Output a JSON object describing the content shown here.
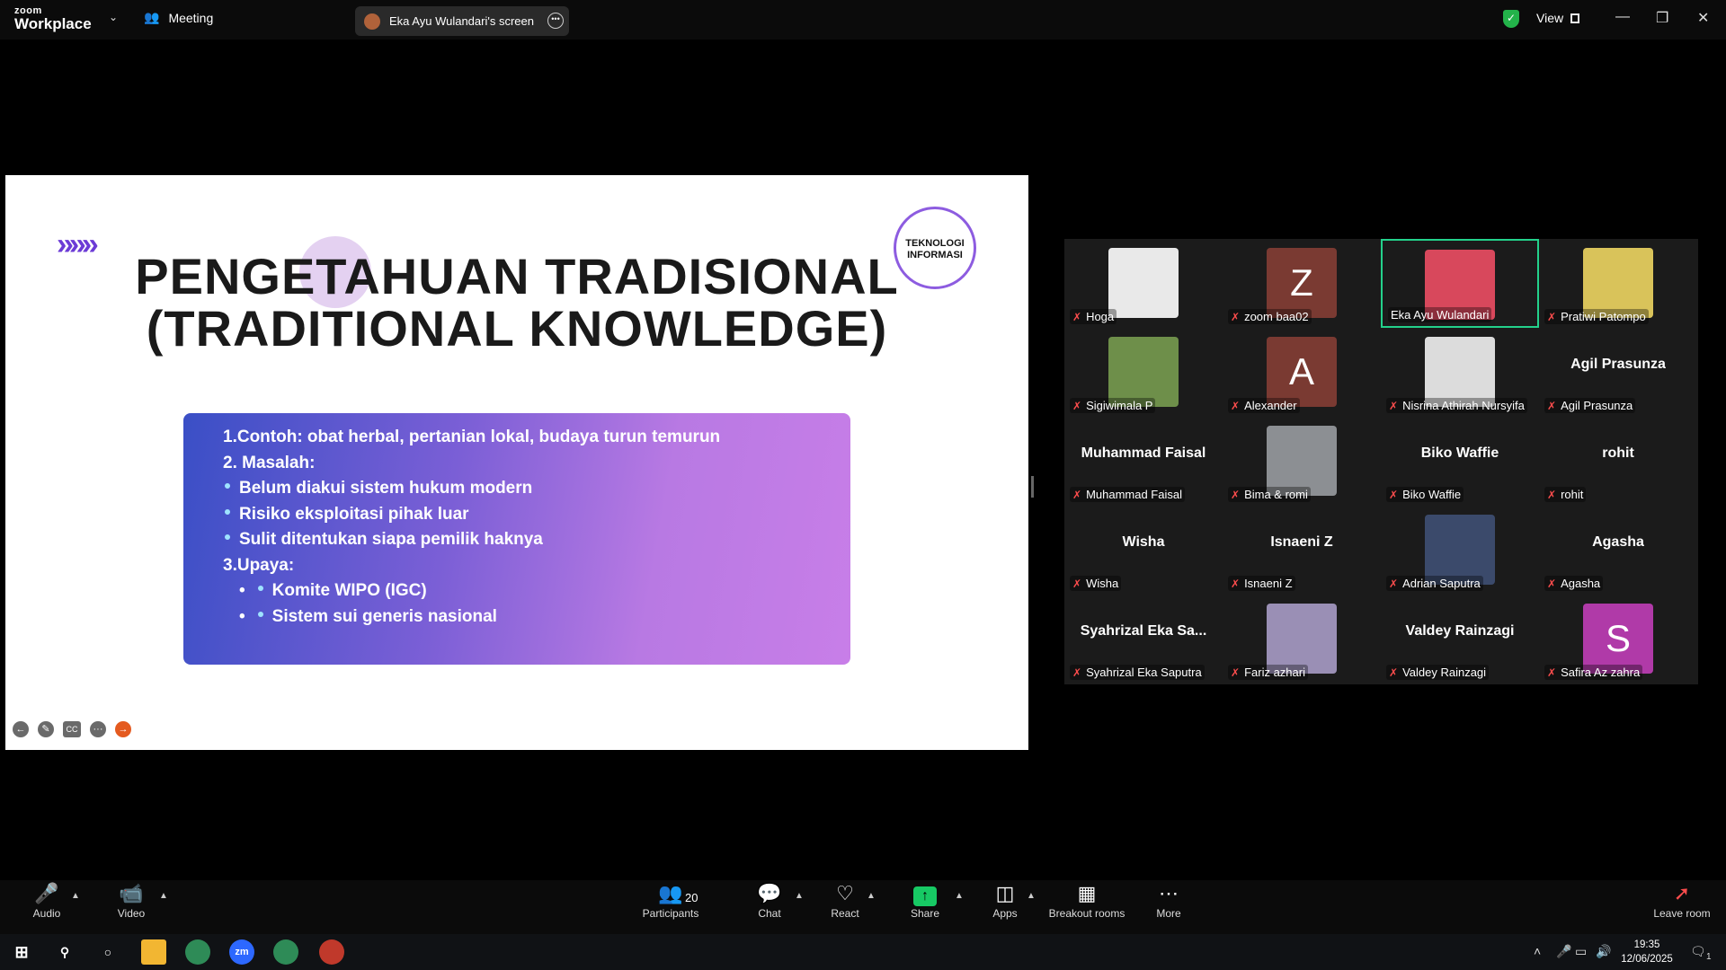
{
  "titlebar": {
    "app_brand_top": "zoom",
    "app_brand_bottom": "Workplace",
    "meeting_label": "Meeting",
    "screen_share_label": "Eka Ayu Wulandari's screen",
    "view_label": "View"
  },
  "slide": {
    "title_line1": "PENGETAHUAN TRADISIONAL",
    "title_line2": "(TRADITIONAL KNOWLEDGE)",
    "badge_line1": "TEKNOLOGI",
    "badge_line2": "INFORMASI",
    "decor_arrows": "»»»",
    "content": {
      "l1": "1.Contoh: obat herbal, pertanian lokal, budaya turun temurun",
      "l2": "2. Masalah:",
      "l3": "Belum diakui sistem hukum modern",
      "l4": "Risiko eksploitasi pihak luar",
      "l5": "Sulit ditentukan siapa pemilik haknya",
      "l6": "3.Upaya:",
      "l7": "Komite WIPO (IGC)",
      "l8": "Sistem sui generis nasional"
    }
  },
  "gallery": {
    "tiles": [
      {
        "name": "Hoga",
        "kind": "video",
        "color": "#e9e9e9"
      },
      {
        "name": "zoom baa02",
        "kind": "letter",
        "letter": "Z",
        "color": "#7a3a32"
      },
      {
        "name": "Eka Ayu Wulandari",
        "kind": "video",
        "color": "#d8485c",
        "active": true
      },
      {
        "name": "Pratiwi Patompo",
        "kind": "video",
        "color": "#d9c35a"
      },
      {
        "name": "Sigiwimala P",
        "kind": "video",
        "color": "#6e8f4a"
      },
      {
        "name": "Alexander",
        "kind": "letter",
        "letter": "A",
        "color": "#7a3a32"
      },
      {
        "name": "Nisrina Athirah Nursyifa",
        "kind": "video",
        "color": "#dcdcdc"
      },
      {
        "name": "Agil Prasunza",
        "kind": "name",
        "display": "Agil Prasunza"
      },
      {
        "name": "Muhammad Faisal",
        "kind": "name",
        "display": "Muhammad Faisal"
      },
      {
        "name": "Bima & romi",
        "kind": "video",
        "color": "#8c8f93"
      },
      {
        "name": "Biko Waffie",
        "kind": "name",
        "display": "Biko Waffie"
      },
      {
        "name": "rohit",
        "kind": "name",
        "display": "rohit"
      },
      {
        "name": "Wisha",
        "kind": "name",
        "display": "Wisha"
      },
      {
        "name": "Isnaeni Z",
        "kind": "name",
        "display": "Isnaeni Z"
      },
      {
        "name": "Adrian Saputra",
        "kind": "video",
        "color": "#3b4a6b"
      },
      {
        "name": "Agasha",
        "kind": "name",
        "display": "Agasha"
      },
      {
        "name": "Syahrizal Eka Saputra",
        "kind": "name",
        "display": "Syahrizal Eka Sa..."
      },
      {
        "name": "Fariz azhari",
        "kind": "video",
        "color": "#9a8fb5"
      },
      {
        "name": "Valdey Rainzagi",
        "kind": "name",
        "display": "Valdey Rainzagi"
      },
      {
        "name": "Safira Az zahra",
        "kind": "letter",
        "letter": "S",
        "color": "#b03aa8"
      }
    ]
  },
  "controls": {
    "audio": "Audio",
    "video": "Video",
    "participants": "Participants",
    "participants_count": "20",
    "chat": "Chat",
    "react": "React",
    "share": "Share",
    "apps": "Apps",
    "breakout": "Breakout rooms",
    "more": "More",
    "leave": "Leave room"
  },
  "taskbar": {
    "time": "19:35",
    "date": "12/06/2025",
    "notif_count": "1",
    "zoom_icon_text": "zm"
  }
}
